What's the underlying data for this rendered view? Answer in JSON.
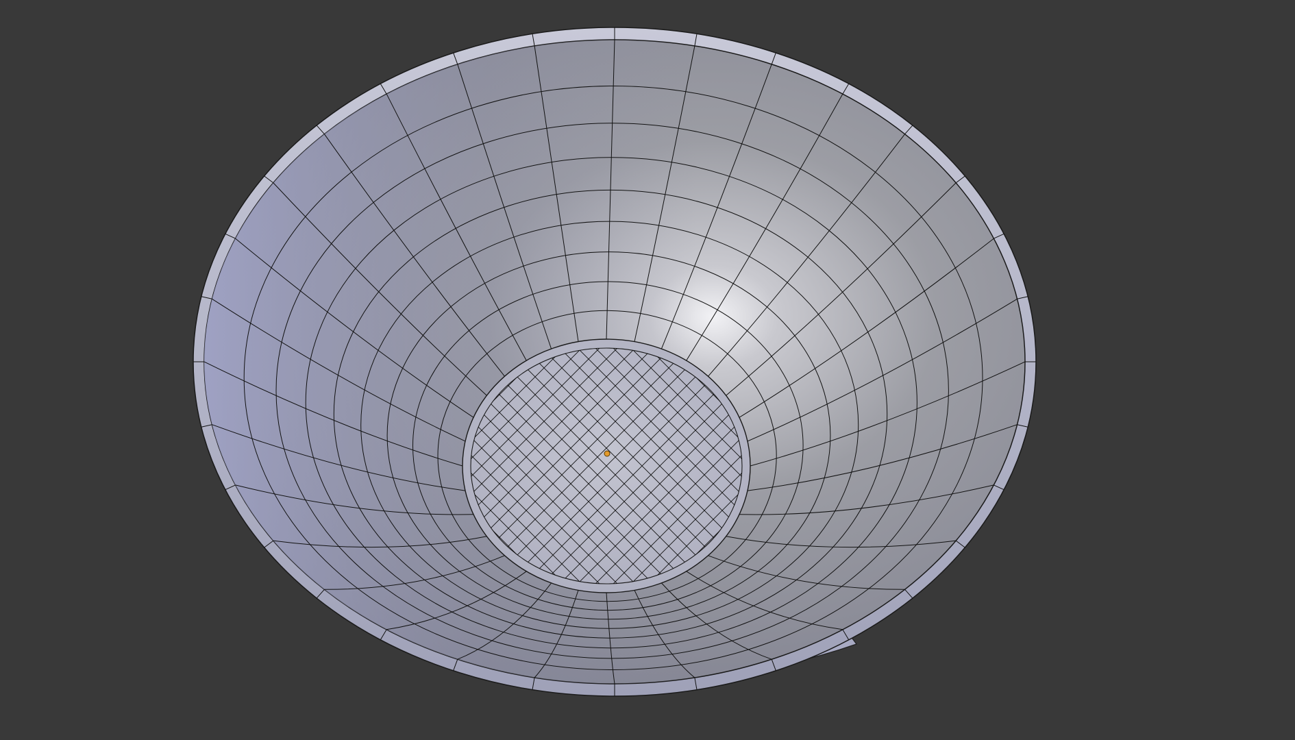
{
  "viewport": {
    "background_color": "#393939",
    "display_mode": "solid-wireframe-overlay"
  },
  "object": {
    "type": "bowl-mesh",
    "surface_color": "#a6a7bd",
    "wire_color": "#111111",
    "origin_marker_color": "#e39a2b",
    "selected": false
  }
}
